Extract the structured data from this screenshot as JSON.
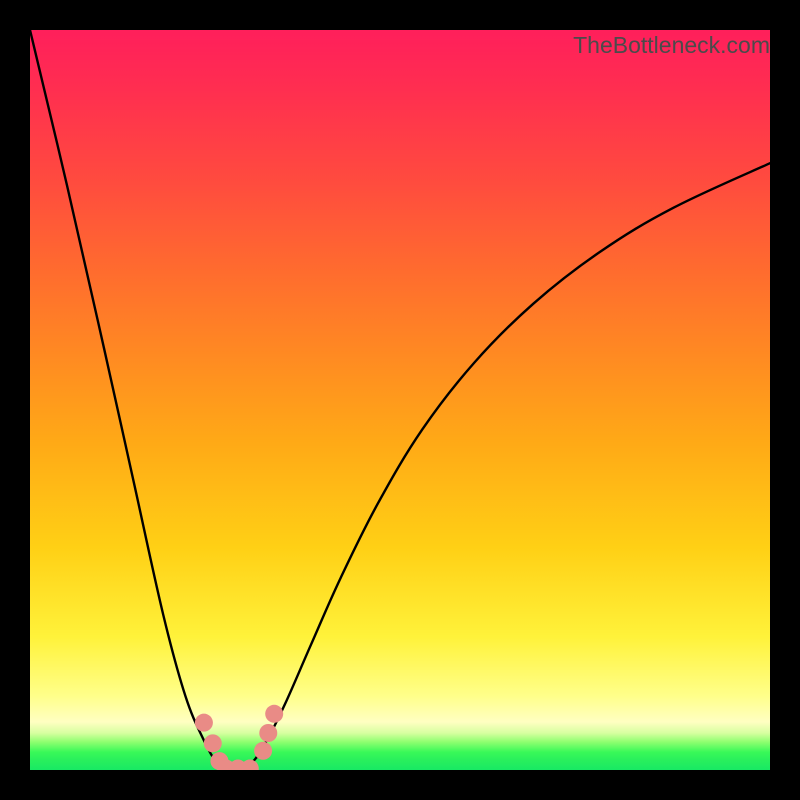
{
  "watermark": "TheBottleneck.com",
  "chart_data": {
    "type": "line",
    "title": "",
    "xlabel": "",
    "ylabel": "",
    "xlim": [
      0,
      1
    ],
    "ylim": [
      0,
      1
    ],
    "curve": {
      "name": "bottleneck-curve",
      "description": "V-shaped bottleneck curve; y is bottleneck severity (1 = top/red, 0 = bottom/green). Minimum near x≈0.27.",
      "x": [
        0.0,
        0.05,
        0.1,
        0.14,
        0.18,
        0.21,
        0.235,
        0.252,
        0.265,
        0.28,
        0.3,
        0.32,
        0.345,
        0.38,
        0.42,
        0.47,
        0.53,
        0.6,
        0.68,
        0.77,
        0.87,
        1.0
      ],
      "y": [
        1.0,
        0.79,
        0.57,
        0.39,
        0.21,
        0.1,
        0.04,
        0.01,
        0.0,
        0.0,
        0.01,
        0.04,
        0.09,
        0.17,
        0.26,
        0.36,
        0.46,
        0.55,
        0.63,
        0.7,
        0.76,
        0.82
      ]
    },
    "markers": {
      "name": "highlight-dots",
      "color": "#e98b86",
      "radius_px": 9,
      "points_xy": [
        [
          0.235,
          0.064
        ],
        [
          0.247,
          0.036
        ],
        [
          0.256,
          0.012
        ],
        [
          0.265,
          0.002
        ],
        [
          0.281,
          0.002
        ],
        [
          0.297,
          0.002
        ],
        [
          0.315,
          0.026
        ],
        [
          0.322,
          0.05
        ],
        [
          0.33,
          0.076
        ]
      ]
    },
    "background_gradient": {
      "top": "#ff1f5b",
      "upper_mid": "#ff8a22",
      "mid": "#ffd015",
      "lower_mid": "#ffff8a",
      "bottom": "#18e964"
    }
  }
}
